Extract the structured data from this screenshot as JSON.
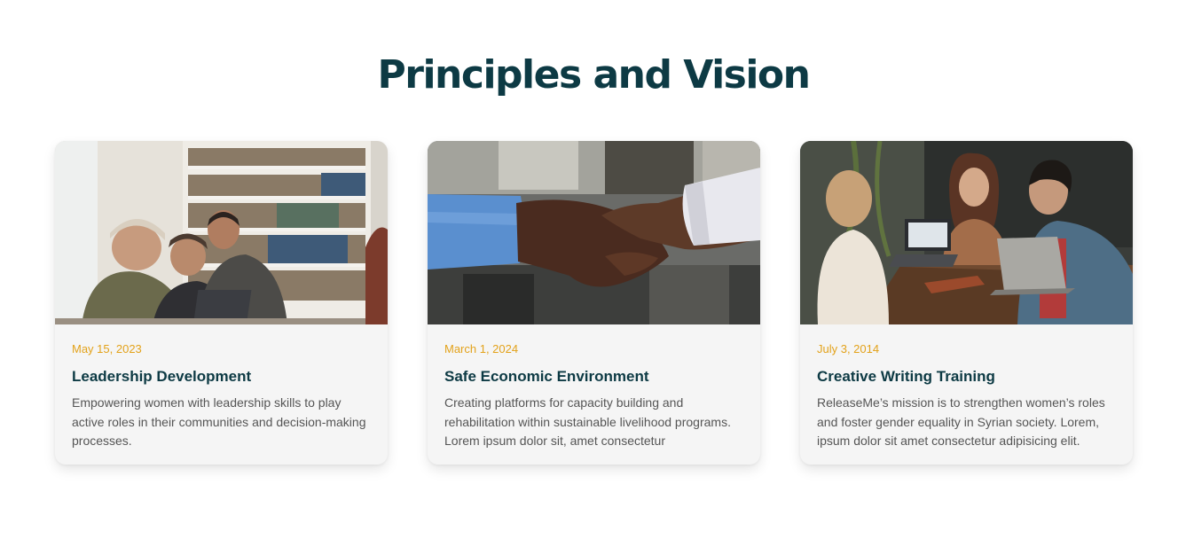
{
  "section": {
    "title": "Principles and Vision"
  },
  "cards": [
    {
      "image": "team-collaboration-photo",
      "date": "May 15, 2023",
      "title": "Leadership Development",
      "text": "Empowering women with leadership skills to play active roles in their communities and decision-making processes."
    },
    {
      "image": "handshake-photo",
      "date": "March 1, 2024",
      "title": "Safe Economic Environment",
      "text": "Creating platforms for capacity building and rehabilitation within sustainable livelihood programs. Lorem ipsum dolor sit, amet consectetur"
    },
    {
      "image": "women-laptop-meeting-photo",
      "date": "July 3, 2014",
      "title": "Creative Writing Training",
      "text": "ReleaseMe’s mission is to strengthen women’s roles and foster gender equality in Syrian society. Lorem, ipsum dolor sit amet consectetur adipisicing elit."
    }
  ],
  "colors": {
    "title": "#0d3a44",
    "date_accent": "#e3a21a",
    "card_bg": "#f5f5f5",
    "body_text": "#555555"
  }
}
